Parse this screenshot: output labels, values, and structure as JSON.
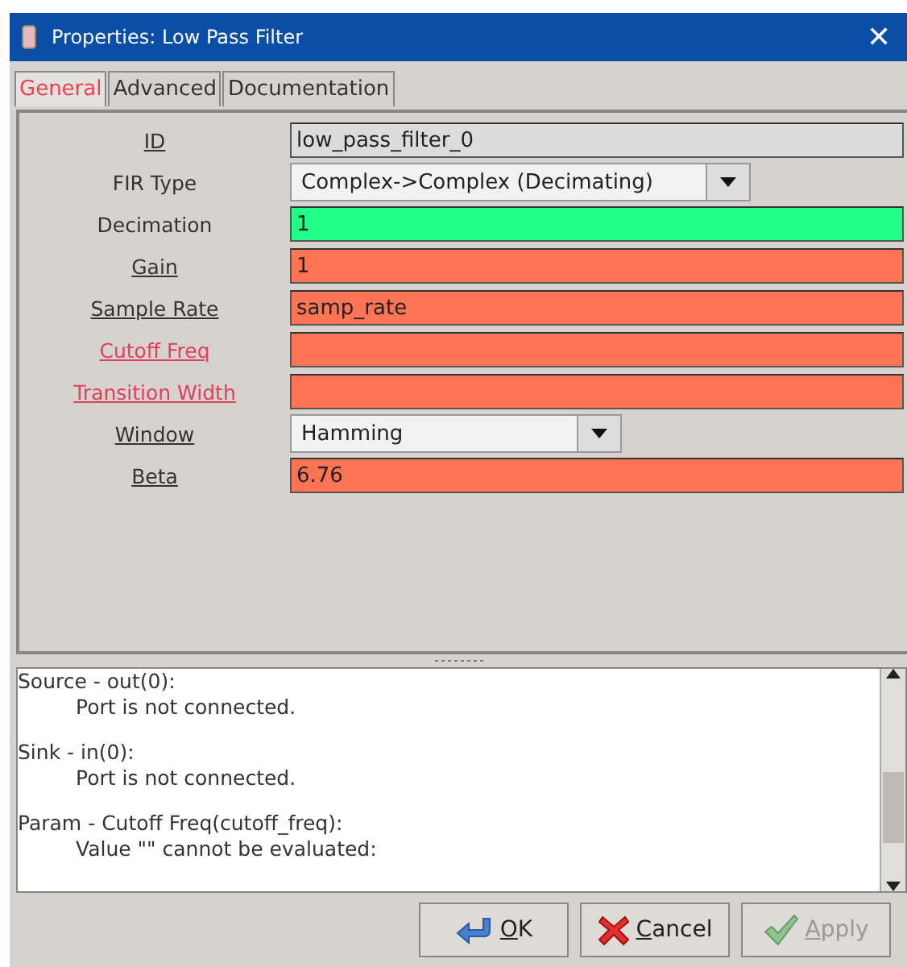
{
  "window": {
    "title": "Properties: Low Pass Filter",
    "close": "✕"
  },
  "tabs": [
    {
      "label": "General",
      "selected": true,
      "error": true
    },
    {
      "label": "Advanced",
      "selected": false,
      "error": false
    },
    {
      "label": "Documentation",
      "selected": false,
      "error": false
    }
  ],
  "params": [
    {
      "label": "ID",
      "underlined": true,
      "error": false,
      "kind": "text",
      "readonly": true,
      "value": "low_pass_filter_0"
    },
    {
      "label": "FIR Type",
      "underlined": false,
      "error": false,
      "kind": "dropdown",
      "wide": true,
      "value": "Complex->Complex (Decimating)"
    },
    {
      "label": "Decimation",
      "underlined": false,
      "error": false,
      "kind": "text",
      "readonly": false,
      "valid": true,
      "value": "1"
    },
    {
      "label": "Gain",
      "underlined": true,
      "error": false,
      "kind": "text",
      "readonly": false,
      "valid": false,
      "value": "1"
    },
    {
      "label": "Sample Rate",
      "underlined": true,
      "error": false,
      "kind": "text",
      "readonly": false,
      "valid": false,
      "value": "samp_rate"
    },
    {
      "label": "Cutoff Freq",
      "underlined": true,
      "error": true,
      "kind": "text",
      "readonly": false,
      "valid": false
    },
    {
      "label": "Transition Width",
      "underlined": true,
      "error": true,
      "kind": "text",
      "readonly": false,
      "valid": false
    },
    {
      "label": "Window",
      "underlined": true,
      "error": false,
      "kind": "dropdown",
      "wide": false,
      "value": "Hamming"
    },
    {
      "label": "Beta",
      "underlined": true,
      "error": false,
      "kind": "text",
      "readonly": false,
      "valid": false,
      "value": "6.76"
    }
  ],
  "messages": [
    {
      "title": "Source - out(0):",
      "detail": "Port is not connected."
    },
    {
      "title": "Sink - in(0):",
      "detail": "Port is not connected."
    },
    {
      "title": "Param - Cutoff Freq(cutoff_freq):",
      "detail": "Value \"\" cannot be evaluated:"
    }
  ],
  "buttons": [
    {
      "kind": "ok",
      "label": "OK",
      "disabled": false
    },
    {
      "kind": "cancel",
      "label": "Cancel",
      "disabled": false
    },
    {
      "kind": "apply",
      "label": "Apply",
      "disabled": true
    }
  ]
}
